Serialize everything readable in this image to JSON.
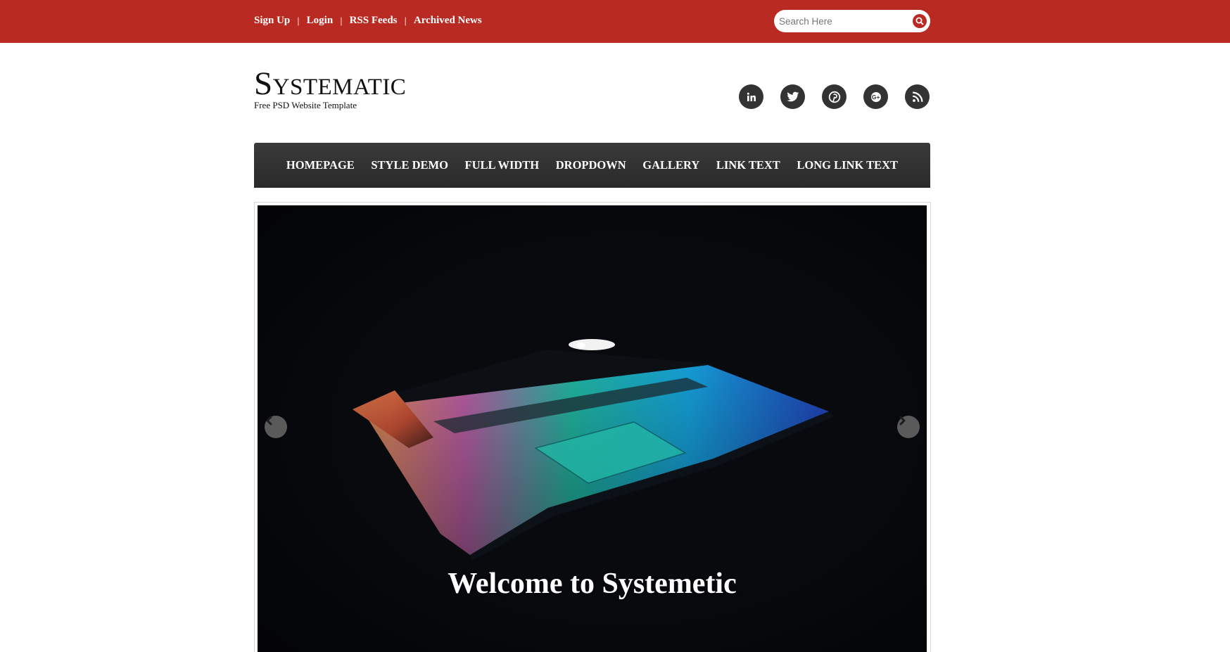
{
  "topbar": {
    "links": [
      "Sign Up",
      "Login",
      "RSS Feeds",
      "Archived News"
    ],
    "search_placeholder": "Search Here"
  },
  "header": {
    "site_title": "Systematic",
    "tagline": "Free PSD Website Template",
    "social_icons": [
      "linkedin-icon",
      "twitter-icon",
      "pinterest-icon",
      "google-plus-icon",
      "rss-icon"
    ]
  },
  "nav": {
    "items": [
      "HOMEPAGE",
      "STYLE DEMO",
      "FULL WIDTH",
      "DROPDOWN",
      "GALLERY",
      "LINK TEXT",
      "LONG LINK TEXT"
    ]
  },
  "slider": {
    "caption": "Welcome to Systemetic"
  },
  "colors": {
    "brand_red": "#b92b22",
    "nav_dark": "#333333",
    "social_bg": "#333333"
  }
}
